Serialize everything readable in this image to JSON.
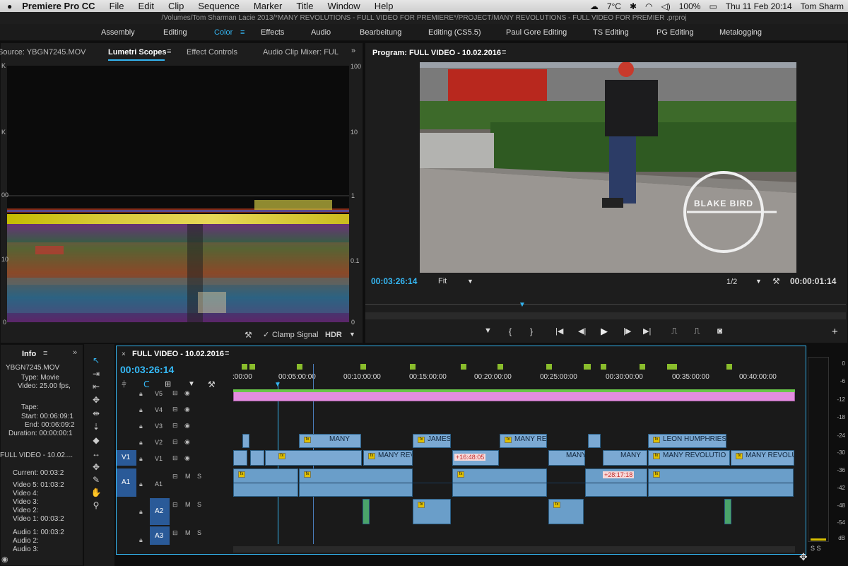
{
  "menubar": {
    "apple": "",
    "app": "Premiere Pro CC",
    "items": [
      "File",
      "Edit",
      "Clip",
      "Sequence",
      "Marker",
      "Title",
      "Window",
      "Help"
    ],
    "temp": "7°C",
    "battery": "100%",
    "clock": "Thu 11 Feb  20:14",
    "user": "Tom Sharm"
  },
  "title": "/Volumes/Tom Sharman Lacie 2013/*MANY REVOLUTIONS - FULL VIDEO FOR PREMIERE*/PROJECT/MANY REVOLUTIONS - FULL VIDEO FOR PREMIER .prproj",
  "workspaces": [
    "Assembly",
    "Editing",
    "Color",
    "Effects",
    "Audio",
    "Bearbeitung",
    "Editing (CS5.5)",
    "Paul Gore Editing",
    "TS Editing",
    "PG Editing",
    "Metalogging"
  ],
  "workspace_active": "Color",
  "left_tabs": {
    "source": "Source: YBGN7245.MOV",
    "lumetri": "Lumetri Scopes",
    "effect_controls": "Effect Controls",
    "audio_mixer": "Audio Clip Mixer: FUL"
  },
  "scope": {
    "left_labels": [
      "K",
      "K",
      "00",
      "10",
      "0"
    ],
    "right_labels": [
      "100",
      "10",
      "1",
      "0.1",
      "0"
    ],
    "clamp": "Clamp Signal",
    "hdr": "HDR"
  },
  "program": {
    "title": "Program: FULL VIDEO - 10.02.2016",
    "timecode": "00:03:26:14",
    "fit": "Fit",
    "res": "1/2",
    "duration": "00:00:01:14"
  },
  "info": {
    "tab": "Info",
    "filename": "YBGN7245.MOV",
    "type": "Type: Movie",
    "video": "Video: 25.00 fps,",
    "tape": "Tape:",
    "start": "Start: 00:06:09:1",
    "end": "End: 00:06:09:2",
    "duration": "Duration: 00:00:00:1",
    "seq": "FULL VIDEO - 10.02....",
    "current": "Current: 00:03:2",
    "v5": "Video 5: 01:03:2",
    "v4": "Video 4:",
    "v3": "Video 3:",
    "v2": "Video 2:",
    "v1": "Video 1: 00:03:2",
    "a1": "Audio 1: 00:03:2",
    "a2": "Audio 2:",
    "a3": "Audio 3:"
  },
  "timeline": {
    "seq_tab": "FULL VIDEO - 10.02.2016",
    "timecode": "00:03:26:14",
    "ruler": [
      ":00:00",
      "00:05:00:00",
      "00:10:00:00",
      "00:15:00:00",
      "00:20:00:00",
      "00:25:00:00",
      "00:30:00:00",
      "00:35:00:00",
      "00:40:00:00"
    ],
    "tracks": {
      "v5": "V5",
      "v4": "V4",
      "v3": "V3",
      "v2": "V2",
      "v1": "V1",
      "a1": "A1",
      "a2": "A2",
      "a3": "A3",
      "src_v1": "V1",
      "src_a1": "A1",
      "m": "M",
      "s": "S"
    },
    "clip_labels": {
      "many1": "MANY",
      "james": "JAMES",
      "manyre": "MANY RE",
      "leon": "LEON HUMPHRIES",
      "manyrev1": "MANY REV",
      "many2": "MANY",
      "manyrevol": "MANY REVOLUTIO",
      "manyrevolu": "MANY REVOLU",
      "manyv": "MANY"
    },
    "offsets": [
      "+16:48:05",
      "+28:17:18"
    ]
  },
  "meter": {
    "labels": [
      "0",
      "-6",
      "-12",
      "-18",
      "-24",
      "-30",
      "-36",
      "-42",
      "-48",
      "-54",
      "dB"
    ],
    "solo": "S  S"
  },
  "colors": {
    "accent": "#34b5f1",
    "pink": "#e38ee0",
    "video": "#7ba9d3"
  }
}
